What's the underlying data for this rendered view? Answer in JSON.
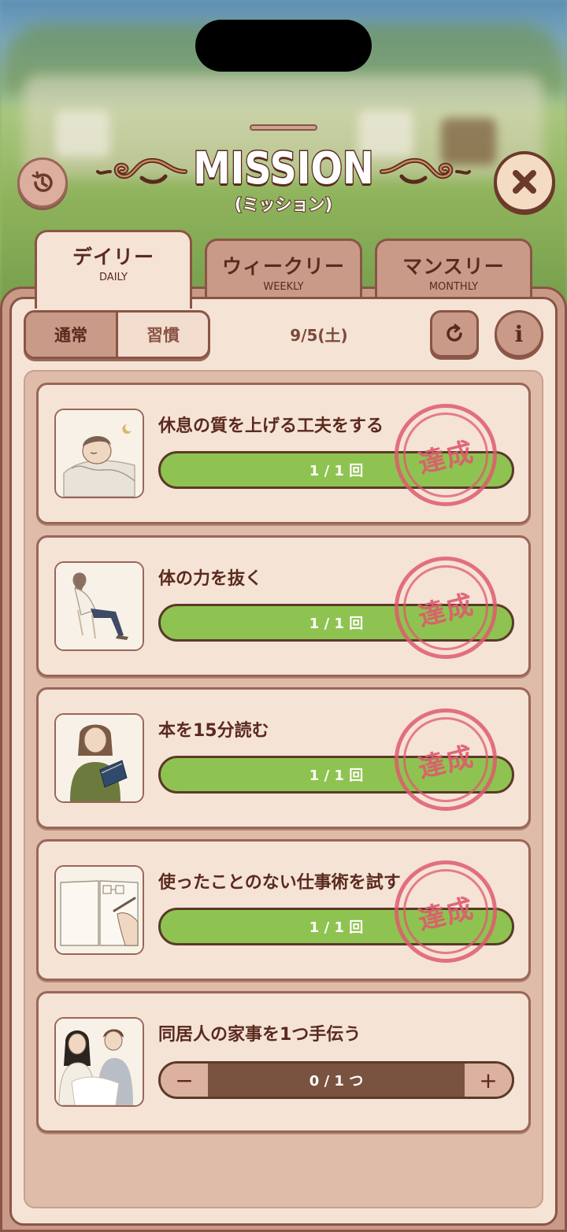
{
  "header": {
    "title": "MISSION",
    "subtitle": "(ミッション)"
  },
  "tabs": [
    {
      "label": "デイリー",
      "sub": "DAILY",
      "active": true
    },
    {
      "label": "ウィークリー",
      "sub": "WEEKLY",
      "active": false
    },
    {
      "label": "マンスリー",
      "sub": "MONTHLY",
      "active": false
    }
  ],
  "filter": {
    "normal": "通常",
    "habit": "習慣"
  },
  "date": "9/5(土)",
  "missions": [
    {
      "title": "休息の質を上げる工夫をする",
      "progress": "1 / 1 回",
      "value": 1,
      "max": 1,
      "stamp": "達成",
      "thumb": "sleeping-person-icon"
    },
    {
      "title": "体の力を抜く",
      "progress": "1 / 1 回",
      "value": 1,
      "max": 1,
      "stamp": "達成",
      "thumb": "relaxing-person-icon"
    },
    {
      "title": "本を15分読む",
      "progress": "1 / 1 回",
      "value": 1,
      "max": 1,
      "stamp": "達成",
      "thumb": "reading-person-icon"
    },
    {
      "title": "使ったことのない仕事術を試す",
      "progress": "1 / 1 回",
      "value": 1,
      "max": 1,
      "stamp": "達成",
      "thumb": "notebook-icon"
    },
    {
      "title": "同居人の家事を1つ手伝う",
      "progress": "0 / 1 つ",
      "value": 0,
      "max": 1,
      "minus": "−",
      "plus": "+",
      "thumb": "couple-icon"
    }
  ],
  "colors": {
    "accent_green": "#8fc351",
    "stamp_red": "#de5a6e",
    "border_brown": "#8a5545"
  }
}
